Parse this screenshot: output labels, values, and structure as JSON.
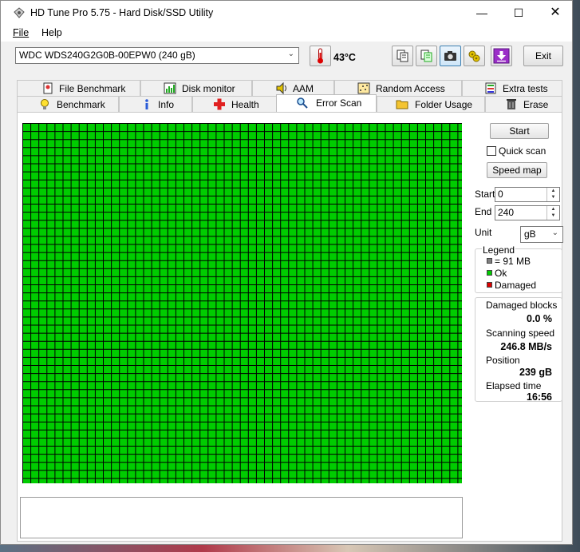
{
  "window": {
    "title": "HD Tune Pro 5.75 - Hard Disk/SSD Utility"
  },
  "menu": [
    {
      "label": "File"
    },
    {
      "label": "Help"
    }
  ],
  "toolbar": {
    "drive": "WDC WDS240G2G0B-00EPW0 (240 gB)",
    "temperature": "43°C",
    "exit_label": "Exit"
  },
  "tabs_top": [
    {
      "label": "File Benchmark",
      "icon": "file-benchmark-icon"
    },
    {
      "label": "Disk monitor",
      "icon": "disk-monitor-icon"
    },
    {
      "label": "AAM",
      "icon": "speaker-icon"
    },
    {
      "label": "Random Access",
      "icon": "random-access-icon"
    },
    {
      "label": "Extra tests",
      "icon": "extra-tests-icon"
    }
  ],
  "tabs_bottom": [
    {
      "label": "Benchmark",
      "icon": "lightbulb-icon"
    },
    {
      "label": "Info",
      "icon": "info-icon"
    },
    {
      "label": "Health",
      "icon": "health-cross-icon"
    },
    {
      "label": "Error Scan",
      "icon": "magnifier-icon"
    },
    {
      "label": "Folder Usage",
      "icon": "folder-icon"
    },
    {
      "label": "Erase",
      "icon": "trash-icon"
    }
  ],
  "active_tab": "Error Scan",
  "scan": {
    "grid_color": "#00cc00",
    "start_button": "Start",
    "quick_scan_label": "Quick scan",
    "quick_scan_checked": false,
    "speed_map_button": "Speed map",
    "start_label": "Start",
    "start_value": "0",
    "end_label": "End",
    "end_value": "240",
    "unit_label": "Unit",
    "unit_value": "gB"
  },
  "legend": {
    "title": "Legend",
    "items": [
      {
        "label": "= 91 MB",
        "color": "#808080"
      },
      {
        "label": "Ok",
        "color": "#00cc00"
      },
      {
        "label": "Damaged",
        "color": "#dd0000"
      }
    ]
  },
  "stats": {
    "damaged_label": "Damaged blocks",
    "damaged_value": "0.0 %",
    "speed_label": "Scanning speed",
    "speed_value": "246.8 MB/s",
    "position_label": "Position",
    "position_value": "239 gB",
    "elapsed_label": "Elapsed time",
    "elapsed_value": "16:56"
  }
}
